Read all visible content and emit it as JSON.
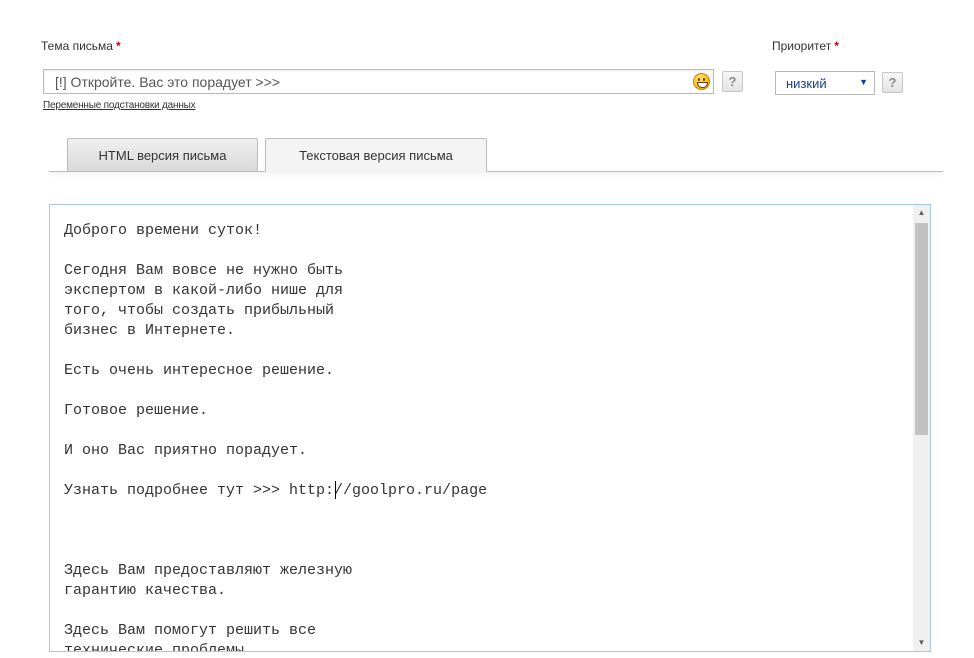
{
  "subject": {
    "label": "Тема письма",
    "required_mark": "*",
    "value": "[!] Откройте. Вас это порадует >>>",
    "emoji_icon": "smiley-icon",
    "help": "?",
    "variables_link": "Переменные подстановки данных"
  },
  "priority": {
    "label": "Приоритет",
    "required_mark": "*",
    "selected": "низкий",
    "help": "?"
  },
  "tabs": [
    {
      "label": "HTML версия письма",
      "active": false
    },
    {
      "label": "Текстовая версия письма",
      "active": true
    }
  ],
  "editor": {
    "text": "Доброго времени суток!\n\nСегодня Вам вовсе не нужно быть\nэкспертом в какой-либо нише для\nтого, чтобы создать прибыльный\nбизнес в Интернете.\n\nЕсть очень интересное решение.\n\nГотовое решение.\n\nИ оно Вас приятно порадует.\n\nУзнать подробнее тут >>> http://goolpro.ru/page\n\n\n\nЗдесь Вам предоставляют железную\nгарантию качества.\n\nЗдесь Вам помогут решить все\nтехнические проблемы."
  },
  "colors": {
    "required": "#d40000",
    "select_text": "#1a3f8c",
    "editor_border": "#a9c8e6"
  }
}
